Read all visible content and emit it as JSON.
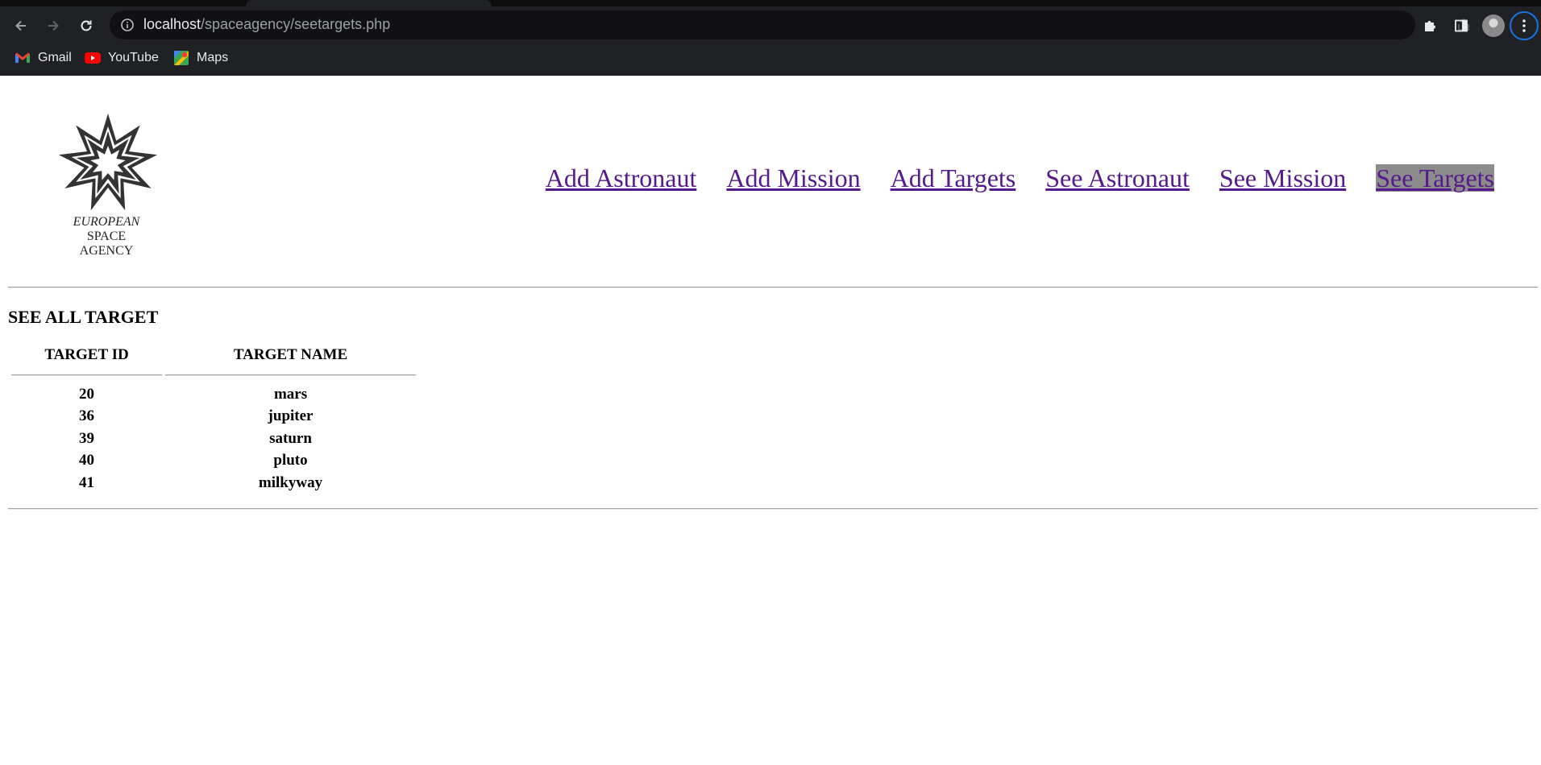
{
  "browser": {
    "url_host": "localhost",
    "url_path": "/spaceagency/seetargets.php",
    "bookmarks": [
      {
        "label": "Gmail",
        "icon": "gmail-icon"
      },
      {
        "label": "YouTube",
        "icon": "youtube-icon"
      },
      {
        "label": "Maps",
        "icon": "maps-icon"
      }
    ]
  },
  "logo": {
    "line1": "EUROPEAN",
    "line2": "SPACE",
    "line3": "AGENCY"
  },
  "nav": {
    "items": [
      {
        "label": "Add Astronaut"
      },
      {
        "label": "Add Mission"
      },
      {
        "label": "Add Targets"
      },
      {
        "label": "See Astronaut"
      },
      {
        "label": "See Mission"
      },
      {
        "label": "See Targets",
        "active": true
      }
    ]
  },
  "main": {
    "title": "SEE ALL TARGET",
    "table": {
      "headers": [
        "TARGET ID",
        "TARGET NAME"
      ],
      "rows": [
        {
          "id": "20",
          "name": "mars"
        },
        {
          "id": "36",
          "name": "jupiter"
        },
        {
          "id": "39",
          "name": "saturn"
        },
        {
          "id": "40",
          "name": "pluto"
        },
        {
          "id": "41",
          "name": "milkyway"
        }
      ]
    }
  },
  "colors": {
    "link": "#551a8b",
    "active_nav_bg": "#8c8c8c",
    "chrome_bg": "#202124",
    "focus_ring": "#1a73e8"
  }
}
